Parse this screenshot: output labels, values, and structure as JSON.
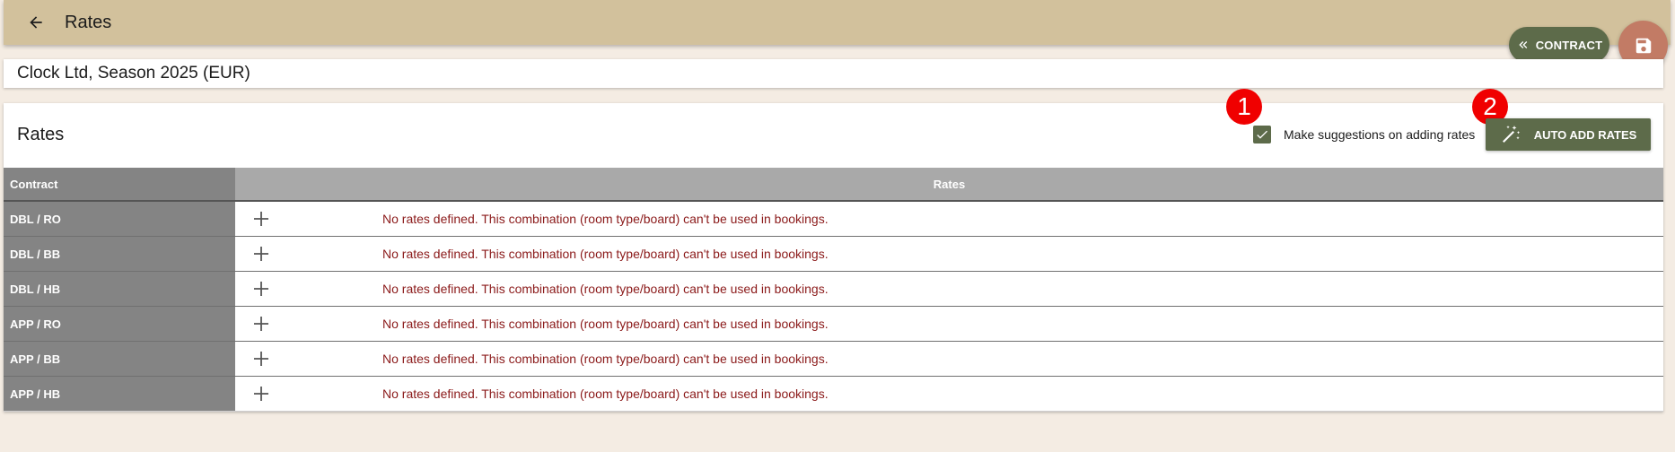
{
  "header": {
    "title": "Rates",
    "back_icon": "arrow-left-icon"
  },
  "contract_button": {
    "label": "CONTRACT",
    "icon": "double-chevron-left-icon"
  },
  "save_button": {
    "icon": "floppy-disk-icon"
  },
  "subtitle": "Clock Ltd, Season 2025 (EUR)",
  "rates_section": {
    "heading": "Rates",
    "suggest_checkbox": {
      "label": "Make suggestions on adding rates",
      "checked": true
    },
    "auto_add_button": {
      "label": "AUTO ADD RATES",
      "icon": "magic-wand-icon"
    },
    "markers": [
      "1",
      "2"
    ]
  },
  "table": {
    "columns": [
      "Contract",
      "Rates"
    ],
    "rows": [
      {
        "label": "DBL / RO",
        "message": "No rates defined. This combination (room type/board) can't be used in bookings."
      },
      {
        "label": "DBL / BB",
        "message": "No rates defined. This combination (room type/board) can't be used in bookings."
      },
      {
        "label": "DBL / HB",
        "message": "No rates defined. This combination (room type/board) can't be used in bookings."
      },
      {
        "label": "APP / RO",
        "message": "No rates defined. This combination (room type/board) can't be used in bookings."
      },
      {
        "label": "APP / BB",
        "message": "No rates defined. This combination (room type/board) can't be used in bookings."
      },
      {
        "label": "APP / HB",
        "message": "No rates defined. This combination (room type/board) can't be used in bookings."
      }
    ]
  },
  "colors": {
    "topbar": "#d2c19c",
    "accent": "#5d6b4a",
    "save": "#c27b65",
    "marker": "#f00000",
    "error_text": "#8b1a1a",
    "background": "#f4ece3"
  }
}
